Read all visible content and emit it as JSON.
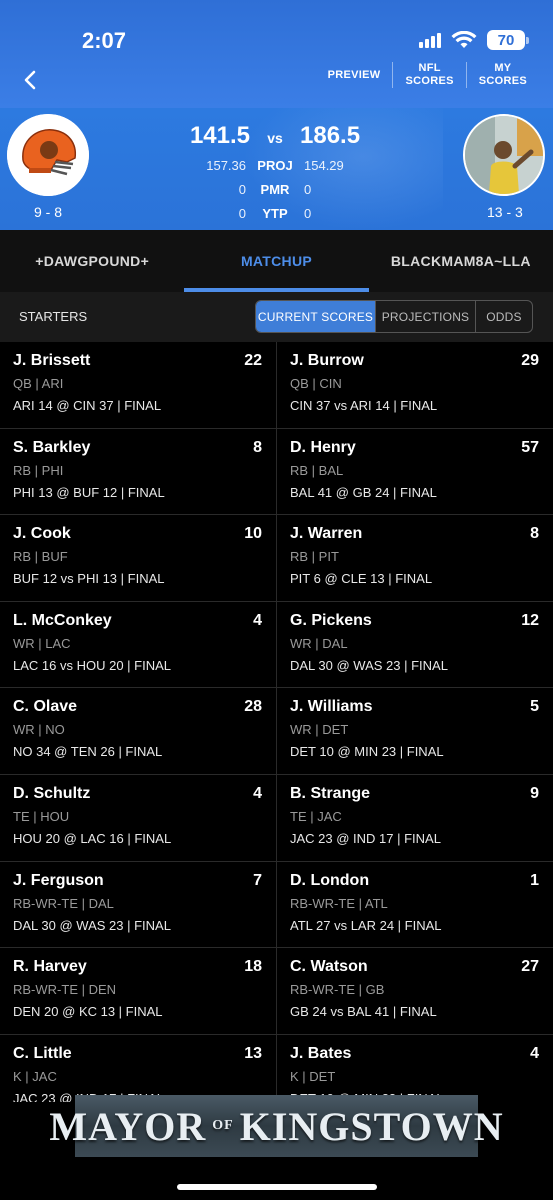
{
  "status_bar": {
    "time": "2:07",
    "battery": "70"
  },
  "header": {
    "back_icon": "chevron-left-icon",
    "nav": [
      {
        "line1": "PREVIEW",
        "line2": ""
      },
      {
        "line1": "NFL",
        "line2": "SCORES"
      },
      {
        "line1": "MY",
        "line2": "SCORES"
      }
    ]
  },
  "matchup": {
    "left": {
      "score": "141.5",
      "proj": "157.36",
      "pmr": "0",
      "ytp": "0",
      "record": "9 - 8"
    },
    "right": {
      "score": "186.5",
      "proj": "154.29",
      "pmr": "0",
      "ytp": "0",
      "record": "13 - 3"
    },
    "vs": "vs",
    "labels": {
      "proj": "PROJ",
      "pmr": "PMR",
      "ytp": "YTP"
    }
  },
  "tabs": [
    "+DAWGPOUND+",
    "MATCHUP",
    "BLACKMAM8A~LLA"
  ],
  "active_tab": 1,
  "starters": {
    "label": "STARTERS",
    "segments": [
      "CURRENT SCORES",
      "PROJECTIONS",
      "ODDS"
    ],
    "active_segment": 0
  },
  "rows": [
    {
      "left": {
        "name": "J. Brissett",
        "pts": "22",
        "pos": "QB | ARI",
        "game": "ARI 14 @ CIN 37 | FINAL"
      },
      "right": {
        "name": "J. Burrow",
        "pts": "29",
        "pos": "QB | CIN",
        "game": "CIN 37 vs ARI 14 | FINAL"
      }
    },
    {
      "left": {
        "name": "S. Barkley",
        "pts": "8",
        "pos": "RB | PHI",
        "game": "PHI 13 @ BUF 12 | FINAL"
      },
      "right": {
        "name": "D. Henry",
        "pts": "57",
        "pos": "RB | BAL",
        "game": "BAL 41 @ GB 24 | FINAL"
      }
    },
    {
      "left": {
        "name": "J. Cook",
        "pts": "10",
        "pos": "RB | BUF",
        "game": "BUF 12 vs PHI 13 | FINAL"
      },
      "right": {
        "name": "J. Warren",
        "pts": "8",
        "pos": "RB | PIT",
        "game": "PIT 6 @ CLE 13 | FINAL"
      }
    },
    {
      "left": {
        "name": "L. McConkey",
        "pts": "4",
        "pos": "WR | LAC",
        "game": "LAC 16 vs HOU 20 | FINAL"
      },
      "right": {
        "name": "G. Pickens",
        "pts": "12",
        "pos": "WR | DAL",
        "game": "DAL 30 @ WAS 23 | FINAL"
      }
    },
    {
      "left": {
        "name": "C. Olave",
        "pts": "28",
        "pos": "WR | NO",
        "game": "NO 34 @ TEN 26 | FINAL"
      },
      "right": {
        "name": "J. Williams",
        "pts": "5",
        "pos": "WR | DET",
        "game": "DET 10 @ MIN 23 | FINAL"
      }
    },
    {
      "left": {
        "name": "D. Schultz",
        "pts": "4",
        "pos": "TE | HOU",
        "game": "HOU 20 @ LAC 16 | FINAL"
      },
      "right": {
        "name": "B. Strange",
        "pts": "9",
        "pos": "TE | JAC",
        "game": "JAC 23 @ IND 17 | FINAL"
      }
    },
    {
      "left": {
        "name": "J. Ferguson",
        "pts": "7",
        "pos": "RB-WR-TE | DAL",
        "game": "DAL 30 @ WAS 23 | FINAL"
      },
      "right": {
        "name": "D. London",
        "pts": "1",
        "pos": "RB-WR-TE | ATL",
        "game": "ATL 27 vs LAR 24 | FINAL"
      }
    },
    {
      "left": {
        "name": "R. Harvey",
        "pts": "18",
        "pos": "RB-WR-TE | DEN",
        "game": "DEN 20 @ KC 13 | FINAL"
      },
      "right": {
        "name": "C. Watson",
        "pts": "27",
        "pos": "RB-WR-TE | GB",
        "game": "GB 24 vs BAL 41 | FINAL"
      }
    },
    {
      "left": {
        "name": "C. Little",
        "pts": "13",
        "pos": "K | JAC",
        "game": "JAC 23 @ IND 17 | FINAL"
      },
      "right": {
        "name": "J. Bates",
        "pts": "4",
        "pos": "K | DET",
        "game": "DET 10 @ MIN 23 | FINAL"
      }
    }
  ],
  "ad": {
    "text_left": "MAYOR",
    "text_mid": "OF",
    "text_right": "KINGSTOWN"
  },
  "colors": {
    "header_blue": "#2f6fd6",
    "accent": "#4d8de8",
    "active_segment": "#3f7ed8"
  }
}
